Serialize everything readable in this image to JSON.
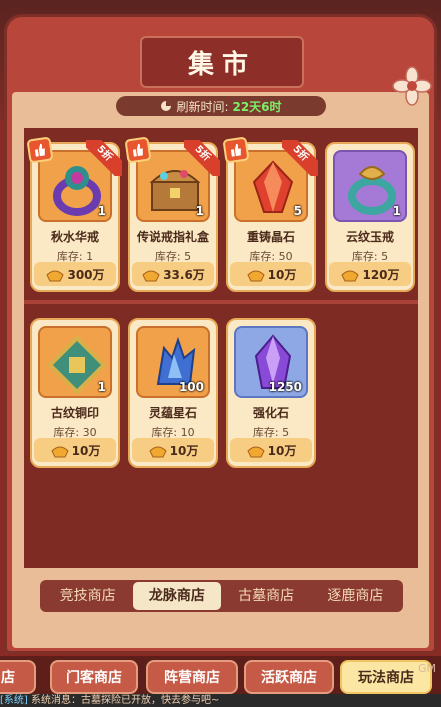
{
  "title": "集市",
  "refresh": {
    "label": "刷新时间:",
    "time": "22天6时"
  },
  "items": [
    {
      "name": "秋水华戒",
      "qty": "1",
      "stock": "库存: 1",
      "price": "300万",
      "discount": "5折",
      "icon": "purple-gem-ring-icon"
    },
    {
      "name": "传说戒指礼盒",
      "qty": "1",
      "stock": "库存: 5",
      "price": "33.6万",
      "discount": "5折",
      "icon": "treasure-chest-icon"
    },
    {
      "name": "重铸晶石",
      "qty": "5",
      "stock": "库存: 50",
      "price": "10万",
      "discount": "5折",
      "icon": "red-crystal-icon"
    },
    {
      "name": "云纹玉戒",
      "qty": "1",
      "stock": "库存: 5",
      "price": "120万",
      "discount": "",
      "icon": "jade-ring-icon"
    },
    {
      "name": "古纹铜印",
      "qty": "1",
      "stock": "库存: 30",
      "price": "10万",
      "discount": "",
      "icon": "bronze-seal-icon"
    },
    {
      "name": "灵蕴星石",
      "qty": "100",
      "stock": "库存: 10",
      "price": "10万",
      "discount": "",
      "icon": "blue-star-stone-icon"
    },
    {
      "name": "强化石",
      "qty": "1250",
      "stock": "库存: 5",
      "price": "10万",
      "discount": "",
      "icon": "purple-crystal-icon"
    }
  ],
  "tabs": [
    "竞技商店",
    "龙脉商店",
    "古墓商店",
    "逐鹿商店"
  ],
  "active_tab": "龙脉商店",
  "shop_tabs": [
    "店",
    "门客商店",
    "阵营商店",
    "活跃商店",
    "玩法商店"
  ],
  "active_shop_tab": "玩法商店",
  "message": {
    "tag": "[系统]",
    "text": "系统消息：古墓探险已开放，快去参与吧~"
  },
  "gm": "GM",
  "colors": {
    "accent": "#b8463b",
    "time": "#7cf06a",
    "price_bg": "#f7cc83"
  }
}
